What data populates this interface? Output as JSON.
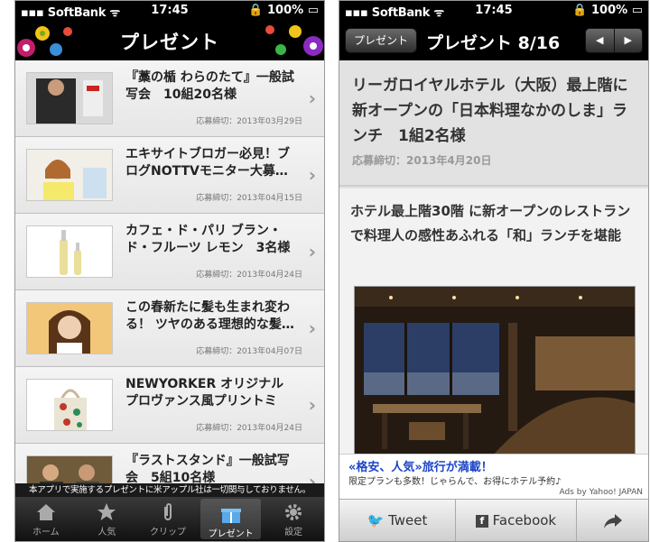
{
  "status": {
    "carrier": "SoftBank",
    "time": "17:45",
    "battery": "100%"
  },
  "left": {
    "nav_title": "プレゼント",
    "items": [
      {
        "title": "『藁の楯 わらのたて』一般試写会　10組20名様",
        "deadline": "応募締切：2013年03月29日"
      },
      {
        "title": "エキサイトブロガー必見！ブログNOTTVモニター大募…",
        "deadline": "応募締切：2013年04月15日"
      },
      {
        "title": "カフェ・ド・パリ ブラン・ド・フルーツ レモン　3名様",
        "deadline": "応募締切：2013年04月24日"
      },
      {
        "title": "この春新たに髪も生まれ変わる！ ツヤのある理想的な髪…",
        "deadline": "応募締切：2013年04月07日"
      },
      {
        "title": "NEWYORKER オリジナル プロヴァンス風プリントミニ…",
        "deadline": "応募締切：2013年04月24日"
      },
      {
        "title": "『ラストスタンド』一般試写会　5組10名様",
        "deadline": ""
      }
    ],
    "notice": "本アプリで実施するプレゼントに米アップル社は一切関与しておりません。",
    "tabs": [
      {
        "label": "ホーム",
        "icon": "home-icon"
      },
      {
        "label": "人気",
        "icon": "star-icon"
      },
      {
        "label": "クリップ",
        "icon": "clip-icon"
      },
      {
        "label": "プレゼント",
        "icon": "gift-icon"
      },
      {
        "label": "設定",
        "icon": "gear-icon"
      }
    ]
  },
  "right": {
    "back_label": "プレゼント",
    "nav_title": "プレゼント 8/16",
    "prev": "◀",
    "next": "▶",
    "heading": "リーガロイヤルホテル（大阪）最上階に新オープンの「日本料理なかのしま」ランチ　1組2名様",
    "deadline": "応募締切：2013年4月20日",
    "lead": "ホテル最上階30階 に新オープンのレストランで料理人の感性あふれる「和」ランチを堪能",
    "ad": {
      "line1": "«格安、人気»旅行が満載！",
      "line2": "限定プランも多数！じゃらんで、お得にホテル予約♪",
      "line3": "Ads by Yahoo! JAPAN"
    },
    "share": {
      "tweet": "Tweet",
      "facebook": "Facebook"
    }
  },
  "colors": {
    "navbar": "#000000",
    "ad_link": "#1e46c8"
  }
}
